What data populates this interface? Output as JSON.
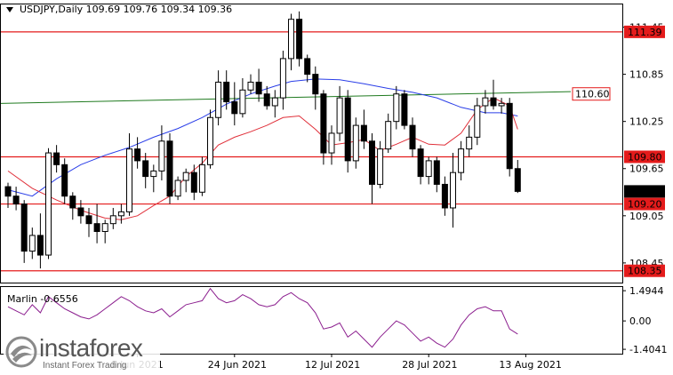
{
  "chart_data": {
    "type": "candlestick",
    "header": {
      "symbol": "USDJPY,Daily",
      "open": "109.69",
      "high": "109.76",
      "low": "109.34",
      "close": "109.36"
    },
    "price_axis": {
      "ylim": [
        108.2,
        111.75
      ],
      "ticks": [
        "111.45",
        "110.85",
        "110.25",
        "109.65",
        "109.05",
        "108.45"
      ]
    },
    "x_ticks": [
      {
        "label": "8 Jun 2021",
        "index": 16
      },
      {
        "label": "24 Jun 2021",
        "index": 28
      },
      {
        "label": "12 Jul 2021",
        "index": 40
      },
      {
        "label": "28 Jul 2021",
        "index": 52
      },
      {
        "label": "13 Aug 2021",
        "index": 64
      }
    ],
    "candles": [
      [
        109.42,
        109.47,
        109.15,
        109.3
      ],
      [
        109.3,
        109.42,
        109.12,
        109.2
      ],
      [
        109.2,
        109.25,
        108.45,
        108.6
      ],
      [
        108.6,
        108.9,
        108.5,
        108.8
      ],
      [
        108.8,
        109.08,
        108.38,
        108.55
      ],
      [
        108.55,
        109.91,
        108.5,
        109.85
      ],
      [
        109.85,
        109.95,
        109.6,
        109.7
      ],
      [
        109.7,
        109.78,
        109.2,
        109.3
      ],
      [
        109.3,
        109.35,
        109.0,
        109.15
      ],
      [
        109.15,
        109.25,
        108.95,
        109.05
      ],
      [
        109.05,
        109.15,
        108.78,
        108.95
      ],
      [
        108.95,
        109.2,
        108.7,
        108.85
      ],
      [
        108.85,
        109.0,
        108.7,
        108.95
      ],
      [
        108.95,
        109.15,
        108.88,
        109.05
      ],
      [
        109.05,
        109.2,
        108.95,
        109.1
      ],
      [
        109.1,
        110.1,
        109.05,
        109.9
      ],
      [
        109.9,
        110.05,
        109.65,
        109.75
      ],
      [
        109.75,
        109.85,
        109.4,
        109.55
      ],
      [
        109.55,
        109.7,
        109.35,
        109.62
      ],
      [
        109.62,
        110.2,
        109.5,
        110.0
      ],
      [
        110.0,
        110.1,
        109.2,
        109.3
      ],
      [
        109.3,
        109.55,
        109.25,
        109.5
      ],
      [
        109.5,
        109.65,
        109.35,
        109.6
      ],
      [
        109.6,
        109.7,
        109.25,
        109.35
      ],
      [
        109.35,
        109.8,
        109.3,
        109.7
      ],
      [
        109.7,
        110.4,
        109.65,
        110.3
      ],
      [
        110.3,
        110.9,
        110.2,
        110.75
      ],
      [
        110.75,
        110.9,
        110.4,
        110.5
      ],
      [
        110.5,
        110.75,
        110.2,
        110.35
      ],
      [
        110.35,
        110.8,
        110.3,
        110.65
      ],
      [
        110.65,
        110.85,
        110.6,
        110.75
      ],
      [
        110.75,
        110.92,
        110.5,
        110.6
      ],
      [
        110.6,
        110.7,
        110.4,
        110.45
      ],
      [
        110.45,
        110.65,
        110.3,
        110.55
      ],
      [
        110.55,
        111.15,
        110.4,
        111.05
      ],
      [
        111.05,
        111.62,
        110.9,
        111.55
      ],
      [
        111.55,
        111.65,
        110.95,
        111.05
      ],
      [
        111.05,
        111.1,
        110.75,
        110.85
      ],
      [
        110.85,
        110.95,
        110.4,
        110.6
      ],
      [
        110.6,
        110.65,
        109.7,
        109.85
      ],
      [
        109.85,
        110.2,
        109.7,
        110.1
      ],
      [
        110.1,
        110.7,
        110.0,
        110.55
      ],
      [
        110.55,
        110.65,
        109.6,
        109.75
      ],
      [
        109.75,
        110.3,
        109.65,
        110.2
      ],
      [
        110.2,
        110.4,
        109.9,
        110.0
      ],
      [
        110.0,
        110.1,
        109.2,
        109.45
      ],
      [
        109.45,
        110.0,
        109.4,
        109.9
      ],
      [
        109.9,
        110.35,
        109.85,
        110.25
      ],
      [
        110.25,
        110.7,
        110.15,
        110.6
      ],
      [
        110.6,
        110.65,
        110.15,
        110.2
      ],
      [
        110.2,
        110.3,
        109.8,
        109.9
      ],
      [
        109.9,
        109.95,
        109.45,
        109.55
      ],
      [
        109.55,
        109.8,
        109.45,
        109.75
      ],
      [
        109.75,
        109.8,
        109.35,
        109.45
      ],
      [
        109.45,
        109.55,
        109.05,
        109.15
      ],
      [
        109.15,
        109.85,
        108.9,
        109.6
      ],
      [
        109.6,
        110.0,
        109.5,
        109.9
      ],
      [
        109.9,
        110.2,
        109.8,
        110.05
      ],
      [
        110.05,
        110.55,
        109.95,
        110.45
      ],
      [
        110.45,
        110.65,
        110.35,
        110.55
      ],
      [
        110.55,
        110.78,
        110.4,
        110.45
      ],
      [
        110.45,
        110.55,
        110.35,
        110.48
      ],
      [
        110.48,
        110.55,
        109.55,
        109.65
      ],
      [
        109.65,
        109.76,
        109.34,
        109.36
      ]
    ],
    "ma_blue": [
      [
        0,
        109.38
      ],
      [
        3,
        109.3
      ],
      [
        6,
        109.52
      ],
      [
        9,
        109.7
      ],
      [
        12,
        109.82
      ],
      [
        15,
        109.92
      ],
      [
        18,
        110.05
      ],
      [
        21,
        110.16
      ],
      [
        24,
        110.3
      ],
      [
        27,
        110.47
      ],
      [
        30,
        110.6
      ],
      [
        33,
        110.7
      ],
      [
        35,
        110.76
      ],
      [
        38,
        110.79
      ],
      [
        41,
        110.78
      ],
      [
        44,
        110.73
      ],
      [
        47,
        110.67
      ],
      [
        50,
        110.62
      ],
      [
        53,
        110.55
      ],
      [
        56,
        110.43
      ],
      [
        59,
        110.36
      ],
      [
        61,
        110.36
      ],
      [
        63,
        110.32
      ]
    ],
    "ma_red": [
      [
        0,
        109.62
      ],
      [
        3,
        109.4
      ],
      [
        6,
        109.25
      ],
      [
        9,
        109.12
      ],
      [
        12,
        109.02
      ],
      [
        14,
        109.0
      ],
      [
        16,
        109.05
      ],
      [
        18,
        109.18
      ],
      [
        20,
        109.3
      ],
      [
        22,
        109.55
      ],
      [
        24,
        109.72
      ],
      [
        26,
        109.95
      ],
      [
        28,
        110.05
      ],
      [
        30,
        110.12
      ],
      [
        32,
        110.2
      ],
      [
        34,
        110.3
      ],
      [
        36,
        110.32
      ],
      [
        38,
        110.15
      ],
      [
        40,
        109.95
      ],
      [
        42,
        109.98
      ],
      [
        44,
        110.02
      ],
      [
        46,
        109.88
      ],
      [
        48,
        109.96
      ],
      [
        50,
        110.05
      ],
      [
        52,
        109.96
      ],
      [
        54,
        109.95
      ],
      [
        56,
        110.1
      ],
      [
        58,
        110.4
      ],
      [
        60,
        110.55
      ],
      [
        62,
        110.45
      ],
      [
        63,
        110.15
      ]
    ],
    "ma_green": [
      [
        0,
        110.48
      ],
      [
        67,
        110.63
      ]
    ],
    "levels": [
      {
        "label": "111.39",
        "value": 111.39,
        "kind": "line"
      },
      {
        "label": "109.80",
        "value": 109.8,
        "kind": "line"
      },
      {
        "label": "109.20",
        "value": 109.2,
        "kind": "line"
      },
      {
        "label": "108.35",
        "value": 108.35,
        "kind": "line"
      },
      {
        "label": "110.60",
        "value": 110.6,
        "kind": "label"
      },
      {
        "label": "109.36",
        "value": 109.36,
        "kind": "current"
      }
    ],
    "indicator": {
      "name": "Marlin",
      "value": "-0.6556",
      "ylim": [
        -1.62,
        1.72
      ],
      "ticks": [
        "1.4944",
        "0.00",
        "-1.4041"
      ],
      "values": [
        0.7,
        0.5,
        0.3,
        0.8,
        0.4,
        1.2,
        0.9,
        0.6,
        0.4,
        0.2,
        0.1,
        0.3,
        0.6,
        0.9,
        1.2,
        1.0,
        0.7,
        0.5,
        0.4,
        0.6,
        0.2,
        0.5,
        0.8,
        0.9,
        1.0,
        1.6,
        1.1,
        0.9,
        1.0,
        1.3,
        1.1,
        0.8,
        0.7,
        0.8,
        1.2,
        1.4,
        1.1,
        0.9,
        0.4,
        -0.4,
        -0.3,
        -0.1,
        -0.8,
        -0.5,
        -0.9,
        -1.3,
        -0.8,
        -0.4,
        0.0,
        -0.2,
        -0.6,
        -1.0,
        -0.8,
        -1.1,
        -1.3,
        -0.9,
        -0.2,
        0.3,
        0.6,
        0.7,
        0.5,
        0.5,
        -0.4,
        -0.65
      ]
    }
  },
  "watermark": {
    "brand": "instaforex",
    "tagline": "Instant Forex Trading"
  },
  "colors": {
    "bull": "#ffffff",
    "bear": "#000000",
    "ma_blue": "#2a3ee8",
    "ma_red": "#e0303a",
    "ma_green": "#1f7a1f",
    "level": "#e41b1b",
    "indicator": "#8b1e8e"
  }
}
